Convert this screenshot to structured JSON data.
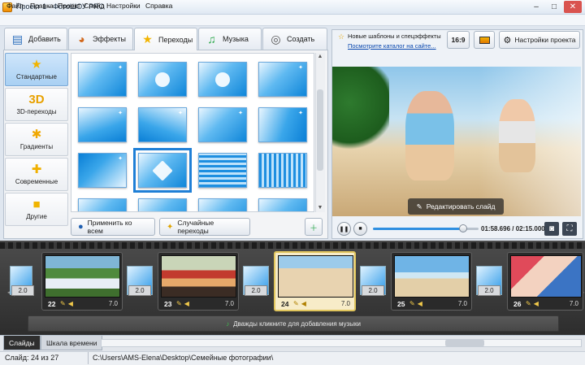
{
  "window": {
    "title": "Проект 1 - ФотоШОУ PRO"
  },
  "menu": [
    "Файл",
    "Правка",
    "Проект",
    "Слайд",
    "Настройки",
    "Справка"
  ],
  "tabs": [
    {
      "label": "Добавить",
      "icon": "folder-icon"
    },
    {
      "label": "Эффекты",
      "icon": "palette-icon"
    },
    {
      "label": "Переходы",
      "icon": "star-icon",
      "active": true
    },
    {
      "label": "Музыка",
      "icon": "music-note-icon"
    },
    {
      "label": "Создать",
      "icon": "film-reel-icon"
    }
  ],
  "categories": [
    {
      "label": "Стандартные",
      "icon": "star-icon",
      "active": true
    },
    {
      "label": "3D-переходы",
      "icon": "3d-icon",
      "glyph": "3D"
    },
    {
      "label": "Градиенты",
      "icon": "gradient-icon"
    },
    {
      "label": "Современные",
      "icon": "puzzle-icon"
    },
    {
      "label": "Другие",
      "icon": "box-icon"
    }
  ],
  "panel_buttons": {
    "apply_all": "Применить ко всем",
    "random": "Случайные переходы"
  },
  "news": {
    "text": "Новые шаблоны и спецэффекты",
    "link": "Посмотрите каталог на сайте..."
  },
  "right_buttons": {
    "aspect": "16:9",
    "settings": "Настройки проекта"
  },
  "preview": {
    "edit_label": "Редактировать слайд"
  },
  "player": {
    "time": "01:58.696 / 02:15.000",
    "progress": 0.85
  },
  "timeline": {
    "slides": [
      {
        "num": "22",
        "dur": "7.0"
      },
      {
        "num": "23",
        "dur": "7.0"
      },
      {
        "num": "24",
        "dur": "7.0",
        "selected": true
      },
      {
        "num": "25",
        "dur": "7.0"
      },
      {
        "num": "26",
        "dur": "7.0"
      }
    ],
    "transitions": [
      "2.0",
      "2.0",
      "2.0",
      "2.0",
      "2.0"
    ],
    "music_hint": "Дважды кликните для добавления музыки"
  },
  "bottom_tabs": [
    "Слайды",
    "Шкала времени"
  ],
  "status": {
    "slide": "Слайд: 24 из 27",
    "path": "C:\\Users\\AMS-Elena\\Desktop\\Семейные фотографии\\"
  },
  "colors": {
    "accent": "#1f7fd6",
    "timeline_bg": "#2d2d2d",
    "selected_slide": "#e0c55c"
  }
}
